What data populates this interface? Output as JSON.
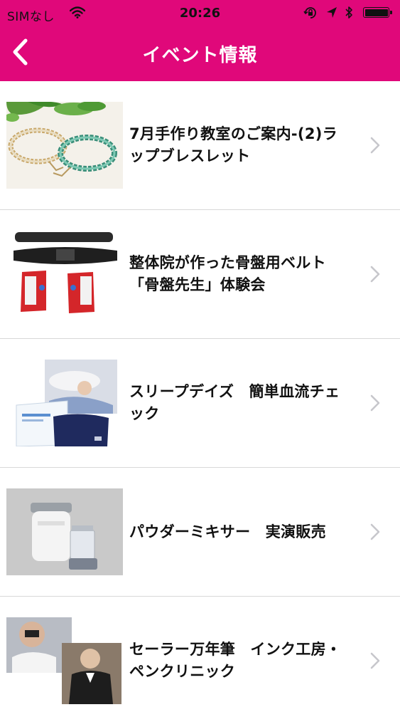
{
  "status_bar": {
    "carrier": "SIMなし",
    "time": "20:26",
    "icons": [
      "wifi-icon",
      "orientation-lock-icon",
      "location-arrow-icon",
      "bluetooth-icon",
      "battery-icon"
    ]
  },
  "nav": {
    "title": "イベント情報",
    "back_icon": "chevron-left-icon"
  },
  "colors": {
    "accent": "#e0087a",
    "divider": "#d8d8d8",
    "chevron": "#c7c7cc"
  },
  "events": [
    {
      "title": "7月手作り教室のご案内-(2)ラップブレスレット",
      "image": "wrap-bracelet-photo"
    },
    {
      "title": "整体院が作った骨盤用ベルト「骨盤先生」体験会",
      "image": "pelvic-belt-photo"
    },
    {
      "title": "スリープデイズ　簡単血流チェック",
      "image": "sleep-days-product-photo"
    },
    {
      "title": "パウダーミキサー　実演販売",
      "image": "powder-mixer-photo"
    },
    {
      "title": "セーラー万年筆　インク工房・ペンクリニック",
      "image": "pen-clinic-photo"
    }
  ]
}
